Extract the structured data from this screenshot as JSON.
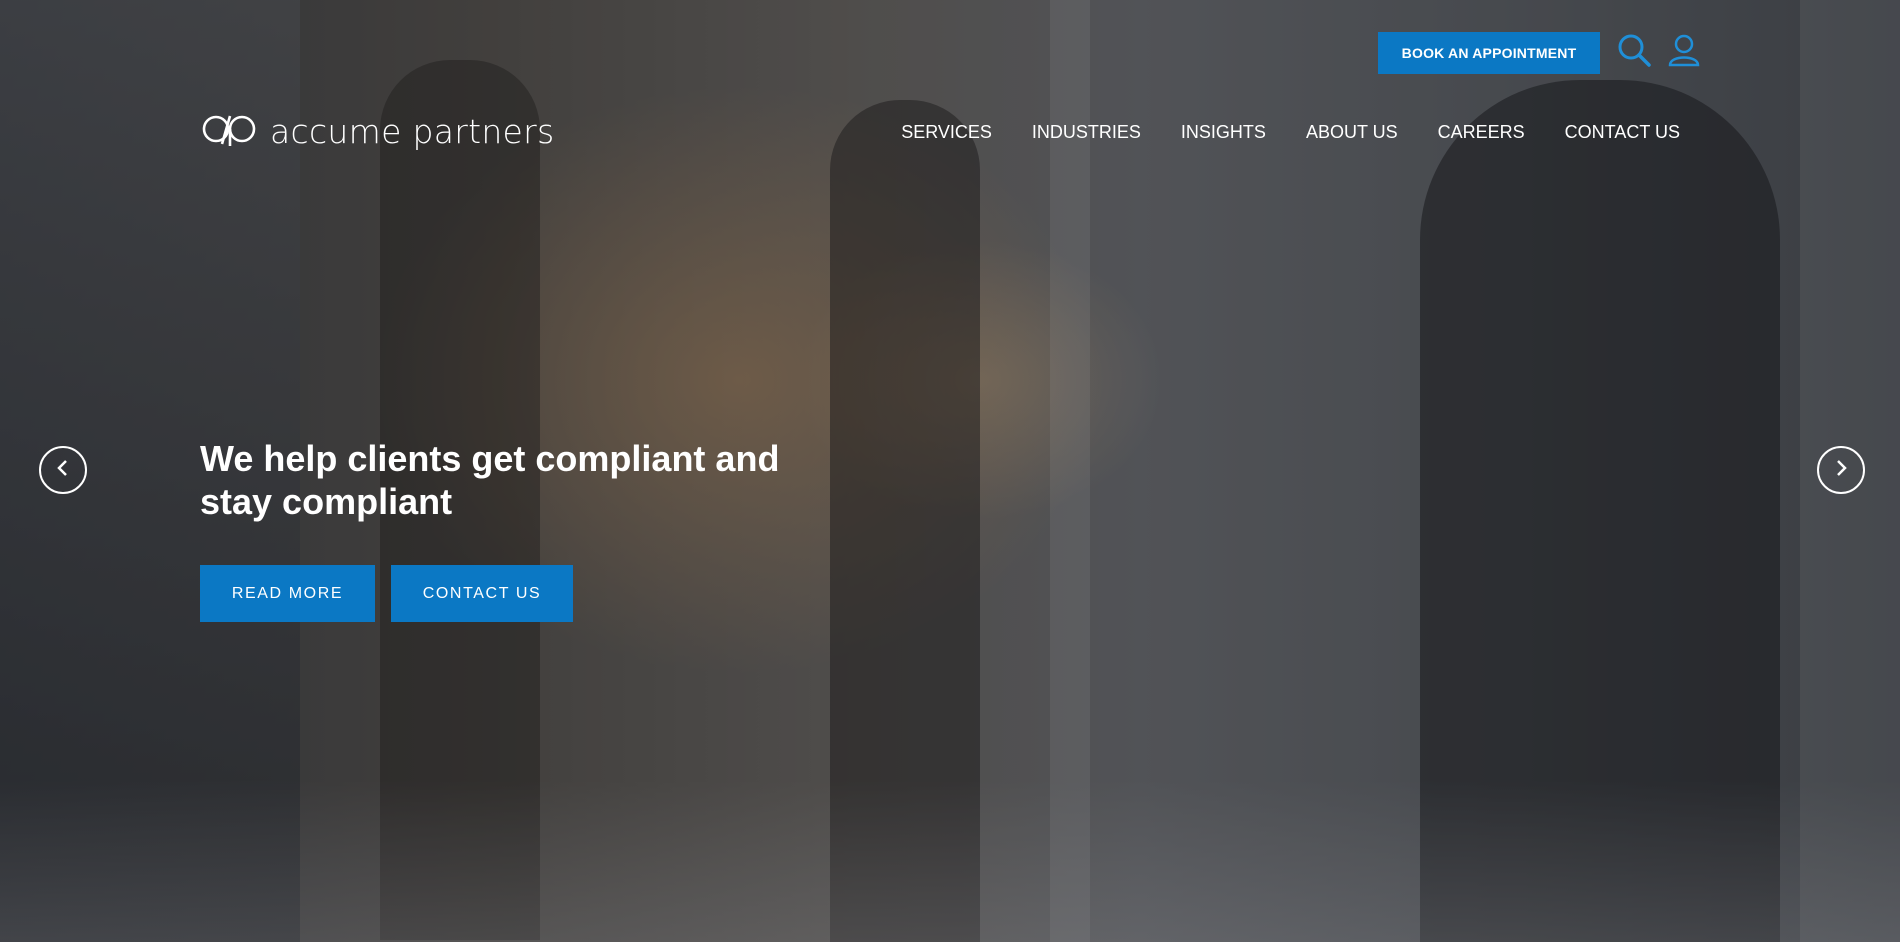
{
  "header": {
    "book_button": "BOOK AN APPOINTMENT",
    "search_icon": "search-icon",
    "account_icon": "user-icon",
    "accent_color": "#0b78c4"
  },
  "logo": {
    "text": "accume partners",
    "icon": "ap-monogram-icon"
  },
  "nav": {
    "items": [
      {
        "label": "SERVICES"
      },
      {
        "label": "INDUSTRIES"
      },
      {
        "label": "INSIGHTS"
      },
      {
        "label": "ABOUT US"
      },
      {
        "label": "CAREERS"
      },
      {
        "label": "CONTACT US"
      }
    ]
  },
  "hero": {
    "headline": "We help clients get compliant and stay compliant",
    "buttons": {
      "read_more": "READ MORE",
      "contact_us": "CONTACT US"
    },
    "prev_icon": "chevron-left-icon",
    "next_icon": "chevron-right-icon"
  }
}
